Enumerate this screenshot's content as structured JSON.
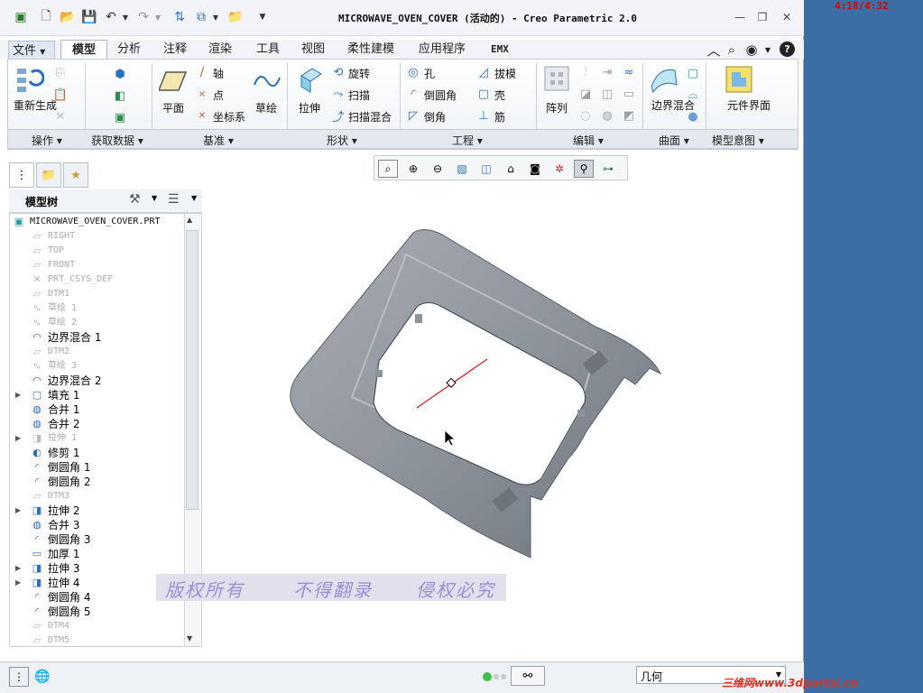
{
  "desktop": {
    "time": "4:18/4:32"
  },
  "window": {
    "title": "MICROWAVE_OVEN_COVER (活动的) - Creo Parametric 2.0"
  },
  "tabs": [
    "文件",
    "模型",
    "分析",
    "注释",
    "渲染",
    "工具",
    "视图",
    "柔性建模",
    "应用程序",
    "EMX"
  ],
  "ribbon": {
    "regen": "重新生成",
    "axis": "轴",
    "point": "点",
    "csys": "坐标系",
    "plane": "平面",
    "sketch": "草绘",
    "extrude": "拉伸",
    "revolve": "旋转",
    "sweep": "扫描",
    "swept_blend": "扫描混合",
    "hole": "孔",
    "round": "倒圆角",
    "chamfer": "倒角",
    "draft": "拔模",
    "shell": "壳",
    "rib": "筋",
    "pattern": "阵列",
    "boundary_blend": "边界混合",
    "component_interface": "元件界面",
    "groups": [
      "操作",
      "获取数据",
      "基准",
      "形状",
      "工程",
      "编辑",
      "曲面",
      "模型意图"
    ]
  },
  "tree": {
    "title": "模型树",
    "root": "MICROWAVE_OVEN_COVER.PRT",
    "items": [
      {
        "label": "RIGHT",
        "state": "gray"
      },
      {
        "label": "TOP",
        "state": "gray"
      },
      {
        "label": "FRONT",
        "state": "gray"
      },
      {
        "label": "PRT_CSYS_DEF",
        "state": "gray"
      },
      {
        "label": "DTM1",
        "state": "gray"
      },
      {
        "label": "草绘 1",
        "state": "gray"
      },
      {
        "label": "草绘 2",
        "state": "gray"
      },
      {
        "label": "边界混合 1",
        "state": "active"
      },
      {
        "label": "DTM2",
        "state": "gray"
      },
      {
        "label": "草绘 3",
        "state": "gray"
      },
      {
        "label": "边界混合 2",
        "state": "active"
      },
      {
        "label": "填充 1",
        "state": "active"
      },
      {
        "label": "合并 1",
        "state": "active"
      },
      {
        "label": "合并 2",
        "state": "active"
      },
      {
        "label": "拉伸 1",
        "state": "gray"
      },
      {
        "label": "修剪 1",
        "state": "active"
      },
      {
        "label": "倒圆角 1",
        "state": "active"
      },
      {
        "label": "倒圆角 2",
        "state": "active"
      },
      {
        "label": "DTM3",
        "state": "gray"
      },
      {
        "label": "拉伸 2",
        "state": "active"
      },
      {
        "label": "合并 3",
        "state": "active"
      },
      {
        "label": "倒圆角 3",
        "state": "active"
      },
      {
        "label": "加厚 1",
        "state": "active"
      },
      {
        "label": "拉伸 3",
        "state": "active"
      },
      {
        "label": "拉伸 4",
        "state": "active"
      },
      {
        "label": "倒圆角 4",
        "state": "active"
      },
      {
        "label": "倒圆角 5",
        "state": "active"
      },
      {
        "label": "DTM4",
        "state": "gray"
      },
      {
        "label": "DTM5",
        "state": "gray"
      }
    ]
  },
  "watermark": [
    "版权所有",
    "不得翻录",
    "侵权必究"
  ],
  "status": {
    "filter": "几何"
  },
  "site_mark": "三维网www.3dportal.cn",
  "colors": {
    "model": "#8e949c",
    "accent": "#1f6fd1",
    "axis_line": "#e02020"
  }
}
